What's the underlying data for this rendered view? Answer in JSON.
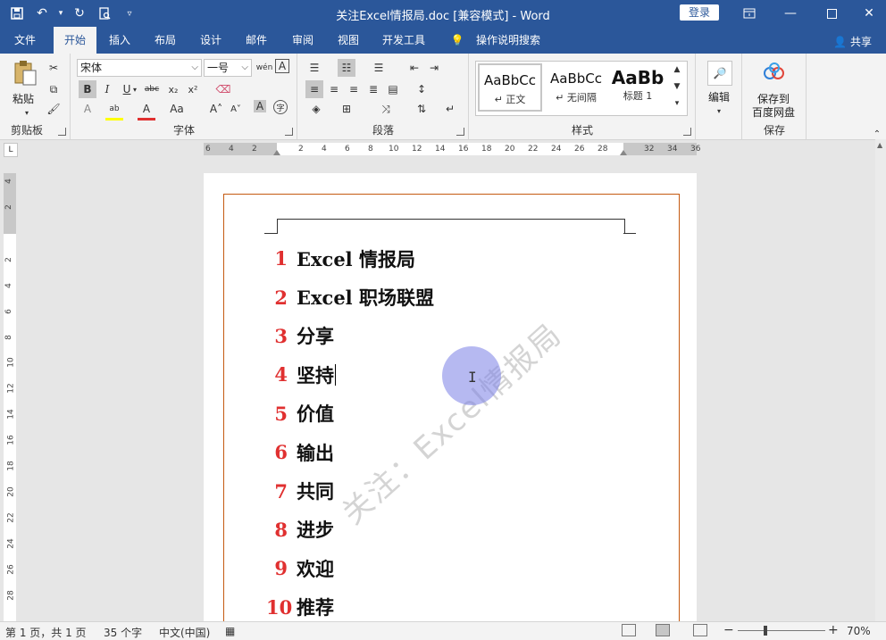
{
  "window": {
    "title": "关注Excel情报局.doc [兼容模式]  -  Word",
    "login_label": "登录"
  },
  "tabs": [
    {
      "label": "文件"
    },
    {
      "label": "开始"
    },
    {
      "label": "插入"
    },
    {
      "label": "布局"
    },
    {
      "label": "设计"
    },
    {
      "label": "邮件"
    },
    {
      "label": "审阅"
    },
    {
      "label": "视图"
    },
    {
      "label": "开发工具"
    },
    {
      "label": "操作说明搜索"
    }
  ],
  "share_label": "共享",
  "ribbon": {
    "clipboard": {
      "paste_label": "粘贴",
      "group_label": "剪贴板"
    },
    "font": {
      "font_name": "宋体",
      "font_size": "一号",
      "group_label": "字体"
    },
    "paragraph": {
      "group_label": "段落"
    },
    "styles": {
      "group_label": "样式",
      "items": [
        {
          "sample": "AaBbCc",
          "name": "↵ 正文"
        },
        {
          "sample": "AaBbCc",
          "name": "↵ 无间隔"
        },
        {
          "sample": "AaBb",
          "name": "标题 1"
        }
      ]
    },
    "editing": {
      "label": "编辑"
    },
    "save": {
      "label1": "保存到",
      "label2": "百度网盘",
      "group_label": "保存"
    }
  },
  "ruler": {
    "h_ticks": [
      "6",
      "4",
      "2",
      "2",
      "4",
      "6",
      "8",
      "10",
      "12",
      "14",
      "16",
      "18",
      "20",
      "22",
      "24",
      "26",
      "28",
      "32",
      "34",
      "36"
    ],
    "v_ticks": [
      "4",
      "2",
      "2",
      "4",
      "6",
      "8",
      "10",
      "12",
      "14",
      "16",
      "18",
      "20",
      "22",
      "24",
      "26",
      "28"
    ]
  },
  "document": {
    "lines": [
      {
        "num": "1",
        "text": "Excel 情报局"
      },
      {
        "num": "2",
        "text": "Excel 职场联盟"
      },
      {
        "num": "3",
        "text": "分享"
      },
      {
        "num": "4",
        "text": "坚持"
      },
      {
        "num": "5",
        "text": "价值"
      },
      {
        "num": "6",
        "text": "输出"
      },
      {
        "num": "7",
        "text": "共同"
      },
      {
        "num": "8",
        "text": "进步"
      },
      {
        "num": "9",
        "text": "欢迎"
      },
      {
        "num": "10",
        "text": "推荐"
      }
    ],
    "watermark": "关注：Excel情报局"
  },
  "status": {
    "page": "第 1 页，共 1 页",
    "words": "35 个字",
    "lang": "中文(中国)",
    "zoom": "70%"
  },
  "colors": {
    "brand": "#2b579a",
    "number_red": "#e03030",
    "page_border": "#c55a11"
  }
}
